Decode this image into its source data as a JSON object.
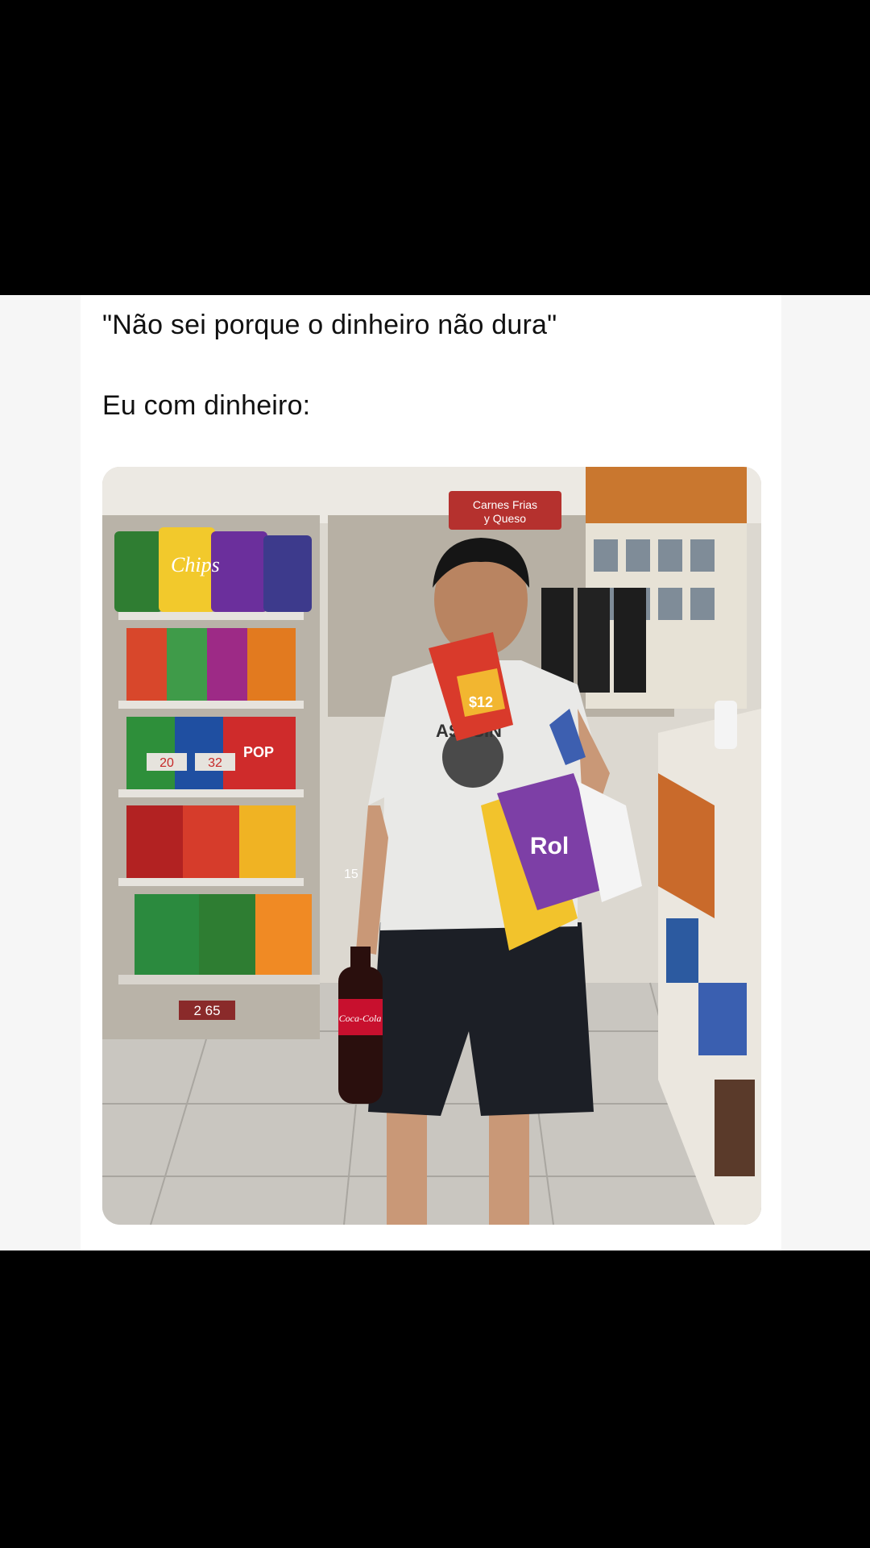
{
  "post": {
    "caption_line1": "\"Não sei porque o dinheiro não dura\"",
    "caption_line2": "Eu com dinheiro:"
  },
  "photo": {
    "sign_line1": "Carnes Frias",
    "sign_line2": "y Queso",
    "snack_label_chips": "Chips",
    "snack_label_rol": "Rol",
    "price_tag_a": "20",
    "price_tag_b": "32",
    "price_tag_c": "2 65",
    "price_tag_d": "15",
    "price_tag_e": "$12",
    "bottle_label": "Coca-Cola",
    "shirt_text": "ASESIN",
    "pop_label": "POP"
  },
  "colors": {
    "background": "#000000",
    "card": "#ffffff",
    "text": "#111111"
  }
}
